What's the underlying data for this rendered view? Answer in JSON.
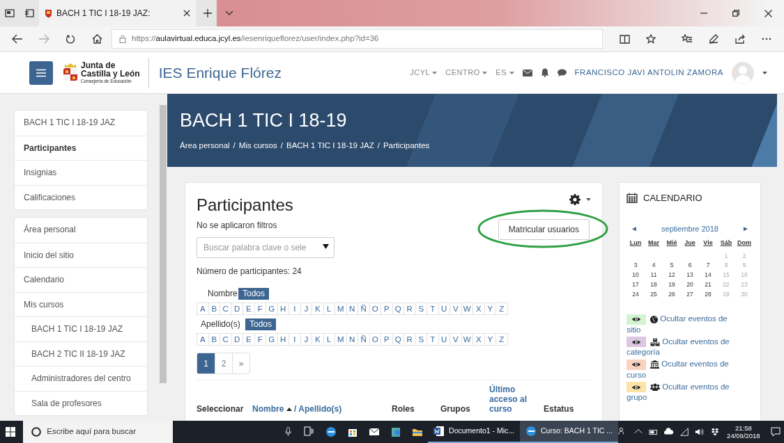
{
  "browser": {
    "tabs": [
      {
        "title": "BACH 1 TIC I 18-19 JAZ:",
        "selected": true
      }
    ],
    "url": {
      "scheme": "https://",
      "host": "aulavirtual.educa.jcyl.es",
      "path": "/iesenriqueflorez/user/index.php?id=36"
    }
  },
  "navbar": {
    "logo_lines": [
      "Junta de",
      "Castilla y León"
    ],
    "logo_subtitle": "Consejería de Educación",
    "site_name": "IES Enrique Flórez",
    "menus": [
      "JCYL",
      "CENTRO",
      "ES"
    ],
    "user_name": "FRANCISCO JAVI ANTOLIN ZAMORA"
  },
  "sidebar": {
    "groups": [
      {
        "items": [
          {
            "label": "BACH 1 TIC I 18-19 JAZ",
            "selected": false
          },
          {
            "label": "Participantes",
            "selected": true
          },
          {
            "label": "Insignias",
            "selected": false
          },
          {
            "label": "Calificaciones",
            "selected": false
          }
        ]
      },
      {
        "items": [
          {
            "label": "Área personal",
            "selected": false
          },
          {
            "label": "Inicio del sitio",
            "selected": false
          },
          {
            "label": "Calendario",
            "selected": false
          },
          {
            "label": "Mis cursos",
            "selected": false,
            "children": [
              {
                "label": "BACH 1 TIC I 18-19 JAZ",
                "selected": false
              },
              {
                "label": "BACH 2 TIC II 18-19 JAZ",
                "selected": false
              },
              {
                "label": "Administradores del centro",
                "selected": false
              },
              {
                "label": "Sala de profesores",
                "selected": false
              }
            ]
          }
        ]
      }
    ]
  },
  "page_header": {
    "title": "BACH 1 TIC I 18-19",
    "breadcrumbs": [
      "Área personal",
      "Mis cursos",
      "BACH 1 TIC I 18-19 JAZ",
      "Participantes"
    ],
    "separator": "/"
  },
  "participants": {
    "title": "Participantes",
    "filter_status": "No se aplicaron filtros",
    "search": {
      "placeholder": "Buscar palabra clave o sele"
    },
    "enrol_button": {
      "label": "Matricular usuarios",
      "circled": true
    },
    "count": "Número de participantes: 24",
    "initials_filters": [
      {
        "label": "Nombre",
        "options": [
          {
            "text": "Todos",
            "selected": true
          },
          {
            "text": "A",
            "selected": false
          },
          {
            "text": "B",
            "selected": false
          },
          {
            "text": "C",
            "selected": false
          },
          {
            "text": "D",
            "selected": false
          },
          {
            "text": "E",
            "selected": false
          },
          {
            "text": "F",
            "selected": false
          },
          {
            "text": "G",
            "selected": false
          },
          {
            "text": "H",
            "selected": false
          },
          {
            "text": "I",
            "selected": false
          },
          {
            "text": "J",
            "selected": false
          },
          {
            "text": "K",
            "selected": false
          },
          {
            "text": "L",
            "selected": false
          },
          {
            "text": "M",
            "selected": false
          },
          {
            "text": "N",
            "selected": false
          },
          {
            "text": "Ñ",
            "selected": false
          },
          {
            "text": "O",
            "selected": false
          },
          {
            "text": "P",
            "selected": false
          },
          {
            "text": "Q",
            "selected": false
          },
          {
            "text": "R",
            "selected": false
          },
          {
            "text": "S",
            "selected": false
          },
          {
            "text": "T",
            "selected": false
          },
          {
            "text": "U",
            "selected": false
          },
          {
            "text": "V",
            "selected": false
          },
          {
            "text": "W",
            "selected": false
          },
          {
            "text": "X",
            "selected": false
          },
          {
            "text": "Y",
            "selected": false
          },
          {
            "text": "Z",
            "selected": false
          }
        ]
      },
      {
        "label": "Apellido(s)",
        "options": [
          {
            "text": "Todos",
            "selected": true
          },
          {
            "text": "A",
            "selected": false
          },
          {
            "text": "B",
            "selected": false
          },
          {
            "text": "C",
            "selected": false
          },
          {
            "text": "D",
            "selected": false
          },
          {
            "text": "E",
            "selected": false
          },
          {
            "text": "F",
            "selected": false
          },
          {
            "text": "G",
            "selected": false
          },
          {
            "text": "H",
            "selected": false
          },
          {
            "text": "I",
            "selected": false
          },
          {
            "text": "J",
            "selected": false
          },
          {
            "text": "K",
            "selected": false
          },
          {
            "text": "L",
            "selected": false
          },
          {
            "text": "M",
            "selected": false
          },
          {
            "text": "N",
            "selected": false
          },
          {
            "text": "Ñ",
            "selected": false
          },
          {
            "text": "O",
            "selected": false
          },
          {
            "text": "P",
            "selected": false
          },
          {
            "text": "Q",
            "selected": false
          },
          {
            "text": "R",
            "selected": false
          },
          {
            "text": "S",
            "selected": false
          },
          {
            "text": "T",
            "selected": false
          },
          {
            "text": "U",
            "selected": false
          },
          {
            "text": "V",
            "selected": false
          },
          {
            "text": "W",
            "selected": false
          },
          {
            "text": "X",
            "selected": false
          },
          {
            "text": "Y",
            "selected": false
          },
          {
            "text": "Z",
            "selected": false
          }
        ]
      }
    ],
    "pagination": [
      {
        "label": "1",
        "selected": true
      },
      {
        "label": "2",
        "selected": false
      },
      {
        "label": "»",
        "selected": false
      }
    ],
    "table_columns": [
      {
        "label": "Seleccionar",
        "link": false,
        "sorted_ascending": false
      },
      {
        "label": "Nombre",
        "link": true,
        "sorted_ascending": true,
        "second_label": "/ Apellido(s)"
      },
      {
        "label": "Roles",
        "link": false,
        "sorted_ascending": false
      },
      {
        "label": "Grupos",
        "link": false,
        "sorted_ascending": false
      },
      {
        "label": "Último acceso al curso",
        "link": true,
        "sorted_ascending": false
      },
      {
        "label": "Estatus",
        "link": false,
        "sorted_ascending": false
      }
    ]
  },
  "calendar": {
    "title": "CALENDARIO",
    "month": "septiembre 2018",
    "prev": "◄",
    "next": "►",
    "weekdays": [
      "Lun",
      "Mar",
      "Mié",
      "Jue",
      "Vie",
      "Sáb",
      "Dom"
    ],
    "weeks": [
      [
        "1",
        "2"
      ],
      [
        "3",
        "4",
        "5",
        "6",
        "7",
        "8",
        "9"
      ],
      [
        "10",
        "11",
        "12",
        "13",
        "14",
        "15",
        "16"
      ],
      [
        "17",
        "18",
        "19",
        "20",
        "21",
        "22",
        "23"
      ],
      [
        "24",
        "25",
        "26",
        "27",
        "28",
        "29",
        "30"
      ]
    ],
    "event_filters": [
      {
        "label": "Ocultar eventos de sitio",
        "kind": "site",
        "color": "#d3f4d0"
      },
      {
        "label": "Ocultar eventos de categoría",
        "kind": "category",
        "color": "#dcc6e2"
      },
      {
        "label": "Ocultar eventos de curso",
        "kind": "course",
        "color": "#fbd2c0"
      },
      {
        "label": "Ocultar eventos de grupo",
        "kind": "group",
        "color": "#fde4a6"
      }
    ]
  },
  "taskbar": {
    "search_placeholder": "Escribe aquí para buscar",
    "apps": [
      {
        "label": "Documento1 - Mic...",
        "kind": "word",
        "selected": false
      },
      {
        "label": "Curso: BACH 1 TIC ...",
        "kind": "edge",
        "selected": true
      }
    ],
    "time": "21:58",
    "date": "24/09/2018"
  }
}
